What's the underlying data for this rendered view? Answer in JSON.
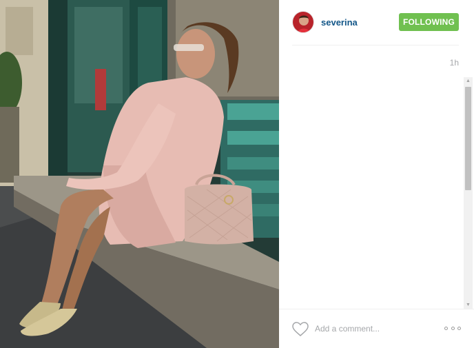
{
  "post": {
    "username": "severina",
    "follow_label": "FOLLOWING",
    "timestamp": "1h",
    "comment_placeholder": "Add a comment...",
    "colors": {
      "username": "#125688",
      "follow_button": "#70c050",
      "muted_text": "#a5a7aa"
    }
  },
  "icons": {
    "heart": "heart-outline-icon",
    "more": "more-options-icon",
    "scroll_up": "chevron-up-icon",
    "scroll_down": "chevron-down-icon"
  }
}
